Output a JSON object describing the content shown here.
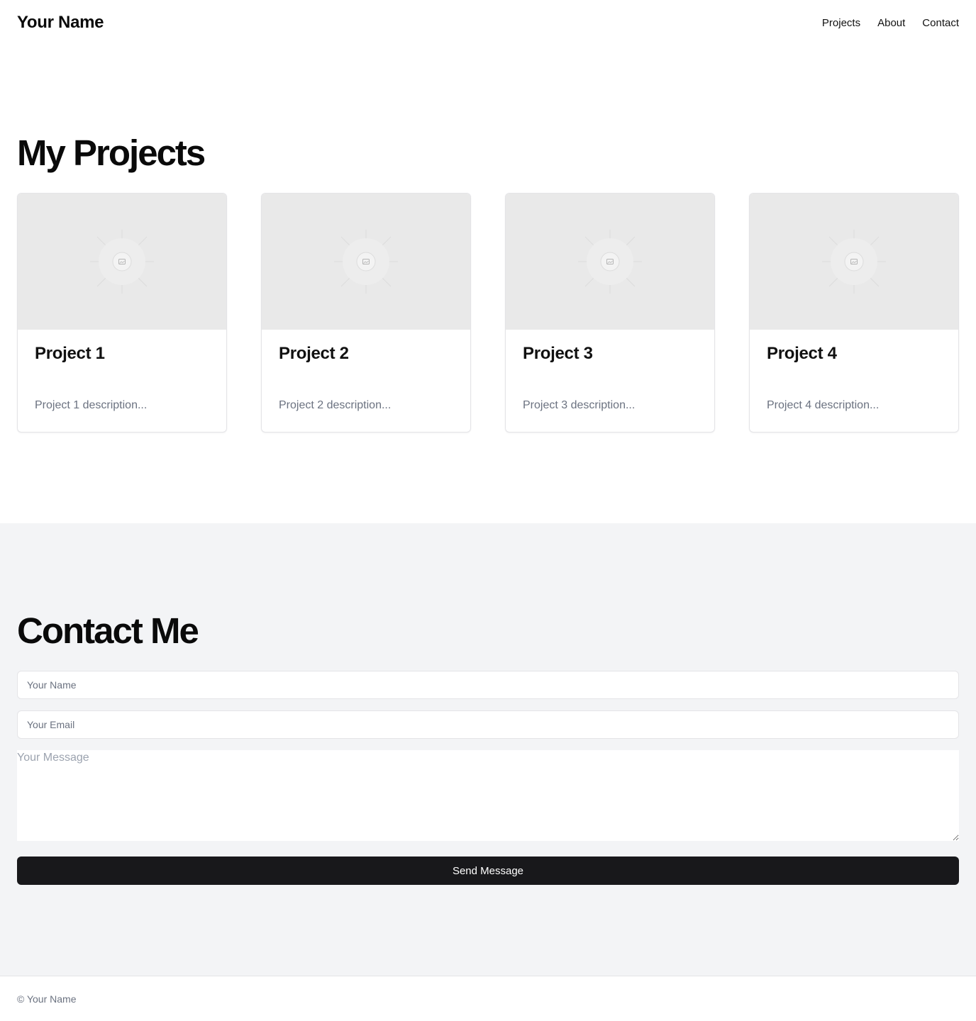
{
  "header": {
    "brand": "Your Name",
    "nav": [
      {
        "label": "Projects"
      },
      {
        "label": "About"
      },
      {
        "label": "Contact"
      }
    ]
  },
  "projects": {
    "title": "My Projects",
    "items": [
      {
        "title": "Project 1",
        "description": "Project 1 description...",
        "image_icon": "image-placeholder-icon"
      },
      {
        "title": "Project 2",
        "description": "Project 2 description...",
        "image_icon": "image-placeholder-icon"
      },
      {
        "title": "Project 3",
        "description": "Project 3 description...",
        "image_icon": "image-placeholder-icon"
      },
      {
        "title": "Project 4",
        "description": "Project 4 description...",
        "image_icon": "image-placeholder-icon"
      }
    ]
  },
  "contact": {
    "title": "Contact Me",
    "name_placeholder": "Your Name",
    "email_placeholder": "Your Email",
    "message_placeholder": "Your Message",
    "submit_label": "Send Message"
  },
  "footer": {
    "copyright": "© Your Name"
  },
  "colors": {
    "section_alt_bg": "#f3f4f6",
    "button_bg": "#18181b",
    "muted_text": "#6b7280",
    "image_placeholder_bg": "#e9e9e9"
  }
}
